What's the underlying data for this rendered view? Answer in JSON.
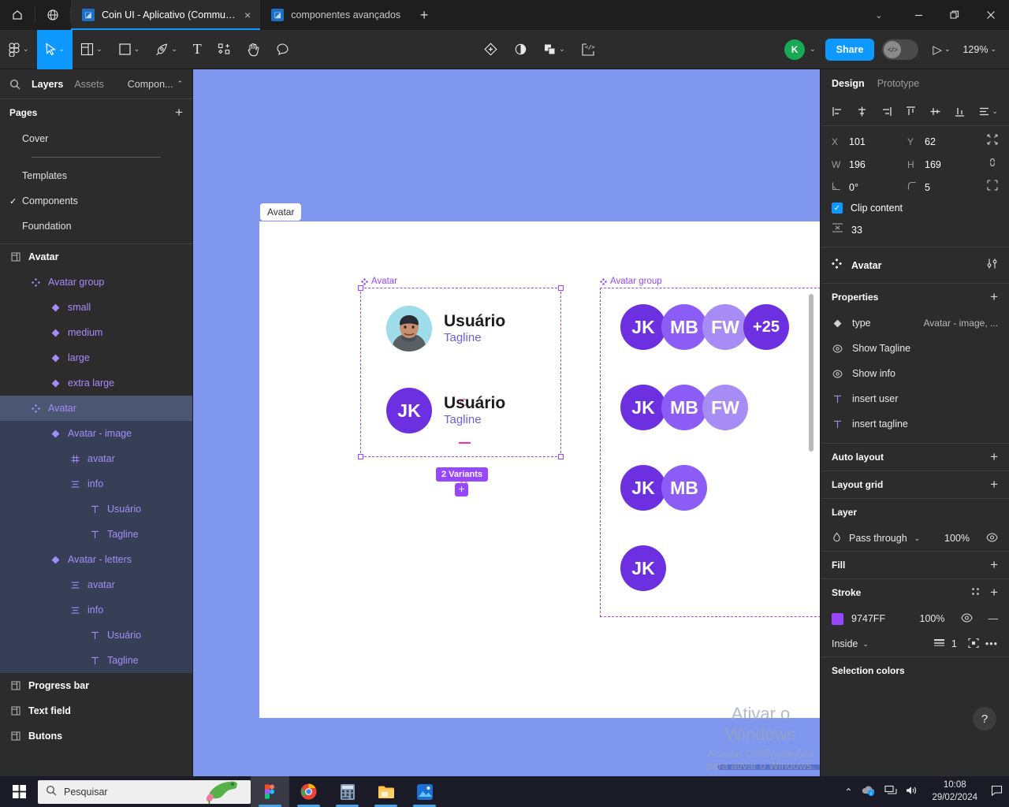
{
  "window": {
    "tabs": [
      {
        "title": "Coin UI - Aplicativo (Community)",
        "favicon": "figma-icon",
        "active": true,
        "close": "×"
      },
      {
        "title": "componentes avançados",
        "favicon": "figma-icon",
        "active": false,
        "close": ""
      }
    ],
    "new_tab": "+",
    "controls": {
      "chevron": "⌄",
      "minimize": "—",
      "maximize": "❐",
      "close": "✕"
    },
    "home_icon": "home-icon",
    "globe_icon": "globe-icon"
  },
  "toolbar": {
    "left_tools": [
      {
        "name": "figma-menu-icon",
        "glyph": "",
        "chevron": "⌄",
        "selected": false
      },
      {
        "name": "move-tool-icon",
        "glyph": "",
        "chevron": "⌄",
        "selected": true
      },
      {
        "name": "frame-tool-icon",
        "glyph": "",
        "chevron": "⌄",
        "selected": false
      },
      {
        "name": "shape-tool-icon",
        "glyph": "",
        "chevron": "⌄",
        "selected": false
      },
      {
        "name": "pen-tool-icon",
        "glyph": "",
        "chevron": "⌄",
        "selected": false
      },
      {
        "name": "text-tool-icon",
        "glyph": "T",
        "chevron": "",
        "selected": false
      },
      {
        "name": "components-tool-icon",
        "glyph": "",
        "chevron": "",
        "selected": false
      },
      {
        "name": "hand-tool-icon",
        "glyph": "",
        "chevron": "",
        "selected": false
      },
      {
        "name": "comment-tool-icon",
        "glyph": "",
        "chevron": "",
        "selected": false
      }
    ],
    "center_tools": [
      {
        "name": "create-component-icon",
        "chevron": ""
      },
      {
        "name": "mask-icon",
        "chevron": ""
      },
      {
        "name": "boolean-union-icon",
        "chevron": "⌄"
      },
      {
        "name": "dev-mode-frame-icon",
        "chevron": ""
      }
    ],
    "user_initial": "K",
    "user_chevron": "⌄",
    "share_label": "Share",
    "code_toggle_glyph": "</>",
    "present_glyph": "▷",
    "present_chevron": "⌄",
    "zoom_level": "129%",
    "zoom_chevron": "⌄",
    "accent_blue": "#0d99ff",
    "user_avatar_color": "#18a957"
  },
  "left_panel": {
    "search_icon": "search-icon",
    "tabs": [
      {
        "label": "Layers",
        "active": true
      },
      {
        "label": "Assets",
        "active": false
      }
    ],
    "components_label": "Compon...",
    "components_chevron": "⌃",
    "pages_title": "Pages",
    "pages_add": "+",
    "pages": [
      {
        "label": "Cover",
        "checked": false,
        "divider_after": true
      },
      {
        "label": "Templates",
        "checked": false,
        "divider_after": false
      },
      {
        "label": "Components",
        "checked": true,
        "divider_after": false
      },
      {
        "label": "Foundation",
        "checked": false,
        "divider_after": false
      }
    ],
    "page_check_glyph": "✓",
    "layers": [
      {
        "label": "Avatar",
        "icon": "frame-icon",
        "indent": 0,
        "style": "frame",
        "state": "none"
      },
      {
        "label": "Avatar group",
        "icon": "component-set-icon",
        "indent": 1,
        "style": "comp-purple",
        "state": "none"
      },
      {
        "label": "small",
        "icon": "component-icon",
        "indent": 2,
        "style": "comp-purple",
        "state": "none"
      },
      {
        "label": "medium",
        "icon": "component-icon",
        "indent": 2,
        "style": "comp-purple",
        "state": "none"
      },
      {
        "label": "large",
        "icon": "component-icon",
        "indent": 2,
        "style": "comp-purple",
        "state": "none"
      },
      {
        "label": "extra large",
        "icon": "component-icon",
        "indent": 2,
        "style": "comp-purple",
        "state": "none"
      },
      {
        "label": "Avatar",
        "icon": "component-set-icon",
        "indent": 1,
        "style": "comp-purple",
        "state": "selected"
      },
      {
        "label": "Avatar - image",
        "icon": "component-icon",
        "indent": 2,
        "style": "comp-purple",
        "state": "child-selected"
      },
      {
        "label": "avatar",
        "icon": "grid-icon",
        "indent": 3,
        "style": "comp-purple",
        "state": "child-selected"
      },
      {
        "label": "info",
        "icon": "autolayout-icon",
        "indent": 3,
        "style": "comp-purple",
        "state": "child-selected"
      },
      {
        "label": "Usuário",
        "icon": "text-icon",
        "indent": 4,
        "style": "comp-purple",
        "state": "child-selected"
      },
      {
        "label": "Tagline",
        "icon": "text-icon",
        "indent": 4,
        "style": "comp-purple",
        "state": "child-selected"
      },
      {
        "label": "Avatar - letters",
        "icon": "component-icon",
        "indent": 2,
        "style": "comp-purple",
        "state": "child-selected"
      },
      {
        "label": "avatar",
        "icon": "autolayout-icon",
        "indent": 3,
        "style": "comp-purple",
        "state": "child-selected"
      },
      {
        "label": "info",
        "icon": "autolayout-icon",
        "indent": 3,
        "style": "comp-purple",
        "state": "child-selected"
      },
      {
        "label": "Usuário",
        "icon": "text-icon",
        "indent": 4,
        "style": "comp-purple",
        "state": "child-selected"
      },
      {
        "label": "Tagline",
        "icon": "text-icon",
        "indent": 4,
        "style": "comp-purple",
        "state": "child-selected"
      },
      {
        "label": "Progress bar",
        "icon": "frame-icon",
        "indent": 0,
        "style": "frame",
        "state": "none"
      },
      {
        "label": "Text field",
        "icon": "frame-icon",
        "indent": 0,
        "style": "frame",
        "state": "none"
      },
      {
        "label": "Butons",
        "icon": "frame-icon",
        "indent": 0,
        "style": "frame",
        "state": "none"
      }
    ]
  },
  "canvas": {
    "background_color": "#8097f0",
    "page_frame_label": "Avatar",
    "selection": {
      "label": "Avatar",
      "variants_badge": "2 Variants",
      "add_variant": "+",
      "stroke_color": "#9747ff"
    },
    "avatar_cards": [
      {
        "kind": "image",
        "name": "Usuário",
        "tagline": "Tagline"
      },
      {
        "kind": "letters",
        "initials": "JK",
        "name": "Usuário",
        "tagline": "Tagline",
        "color": "#6d30e0"
      }
    ],
    "avatar_group": {
      "label": "Avatar group",
      "rows": [
        {
          "avatars": [
            {
              "text": "JK",
              "color": "#6d30e0"
            },
            {
              "text": "MB",
              "color": "#8b5cf6"
            },
            {
              "text": "FW",
              "color": "#a88cf5"
            },
            {
              "text": "+25",
              "color": "#6d30e0"
            }
          ]
        },
        {
          "avatars": [
            {
              "text": "JK",
              "color": "#6d30e0"
            },
            {
              "text": "MB",
              "color": "#8b5cf6"
            },
            {
              "text": "FW",
              "color": "#a88cf5"
            }
          ]
        },
        {
          "avatars": [
            {
              "text": "JK",
              "color": "#6d30e0"
            },
            {
              "text": "MB",
              "color": "#8b5cf6"
            }
          ]
        },
        {
          "avatars": [
            {
              "text": "JK",
              "color": "#6d30e0"
            }
          ]
        }
      ]
    },
    "watermark": {
      "line1": "Ativar o Windows",
      "line2": "Acesse Configurações para ativar o Windows."
    }
  },
  "right_panel": {
    "tabs": [
      {
        "label": "Design",
        "active": true
      },
      {
        "label": "Prototype",
        "active": false
      }
    ],
    "align_icons": [
      "align-left-icon",
      "align-horizontal-center-icon",
      "align-right-icon",
      "align-top-icon",
      "align-vertical-center-icon",
      "align-bottom-icon",
      "distribute-icon"
    ],
    "align_chevron": "⌄",
    "transform": {
      "x_label": "X",
      "x_value": "101",
      "y_label": "Y",
      "y_value": "62",
      "w_label": "W",
      "w_value": "196",
      "h_label": "H",
      "h_value": "169",
      "rotation_value": "0°",
      "corner_value": "5",
      "clip_content_label": "Clip content",
      "clip_content_checked": true,
      "clip_check_glyph": "✓",
      "spacing_value": "33"
    },
    "component": {
      "name": "Avatar",
      "icon": "component-set-icon",
      "settings_icon": "sliders-icon"
    },
    "properties": {
      "title": "Properties",
      "add": "+",
      "items": [
        {
          "icon": "variant-icon",
          "label": "type",
          "value": "Avatar - image, ..."
        },
        {
          "icon": "eye-icon",
          "label": "Show Tagline",
          "value": ""
        },
        {
          "icon": "eye-icon",
          "label": "Show info",
          "value": ""
        },
        {
          "icon": "text-icon",
          "label": "insert user",
          "value": ""
        },
        {
          "icon": "text-icon",
          "label": "insert tagline",
          "value": ""
        }
      ]
    },
    "auto_layout": {
      "title": "Auto layout",
      "add": "+"
    },
    "layout_grid": {
      "title": "Layout grid",
      "add": "+"
    },
    "layer": {
      "title": "Layer",
      "blend_mode": "Pass through",
      "blend_chevron": "⌄",
      "opacity": "100%",
      "visible_icon": "eye-icon"
    },
    "fill": {
      "title": "Fill",
      "add": "+"
    },
    "stroke": {
      "title": "Stroke",
      "settings_icon": "stroke-style-icon",
      "add": "+",
      "color_hex": "9747FF",
      "color_value": "#9747ff",
      "opacity": "100%",
      "visible_icon": "eye-icon",
      "remove": "—",
      "align": "Inside",
      "align_chevron": "⌄",
      "weight": "1",
      "advanced_icon": "advanced-stroke-icon",
      "more": "•••"
    },
    "selection_colors": {
      "title": "Selection colors"
    },
    "help_glyph": "?"
  },
  "taskbar": {
    "start_icon": "windows-start-icon",
    "search_icon": "search-icon",
    "search_placeholder": "Pesquisar",
    "apps": [
      {
        "name": "figma-taskbar-icon",
        "active": true
      },
      {
        "name": "chrome-taskbar-icon",
        "active": false
      },
      {
        "name": "calculator-taskbar-icon",
        "active": false
      },
      {
        "name": "file-explorer-taskbar-icon",
        "active": false
      },
      {
        "name": "photos-taskbar-icon",
        "active": false
      }
    ],
    "tray": {
      "chevron": "⌃",
      "cloud_icon": "onedrive-icon",
      "network_icon": "network-icon",
      "volume_icon": "volume-icon",
      "time": "10:08",
      "date": "29/02/2024",
      "action_center_icon": "action-center-icon"
    }
  }
}
